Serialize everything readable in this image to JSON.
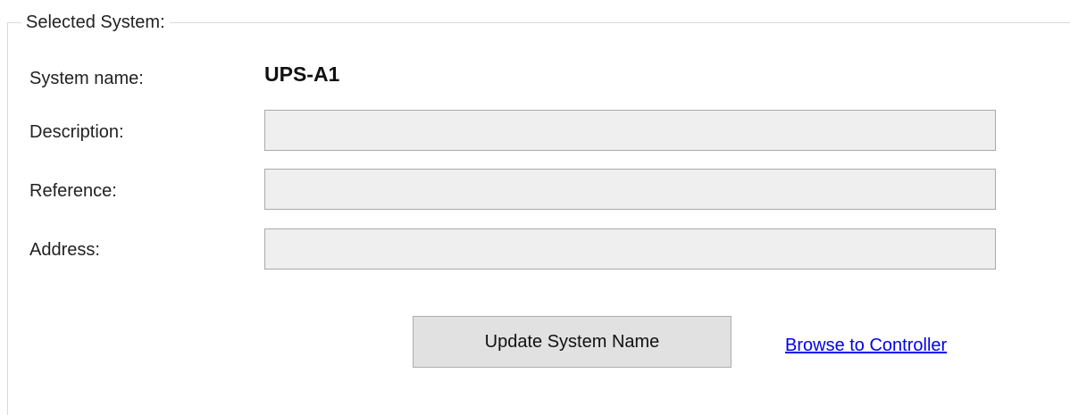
{
  "section": {
    "legend": "Selected System:"
  },
  "system_name": {
    "label": "System name:",
    "value": "UPS-A1"
  },
  "fields": {
    "description": {
      "label": "Description:",
      "value": ""
    },
    "reference": {
      "label": "Reference:",
      "value": ""
    },
    "address": {
      "label": "Address:",
      "value": ""
    }
  },
  "actions": {
    "update_label": "Update System Name",
    "browse_link": "Browse to Controller"
  },
  "colors": {
    "link": "#0000ee",
    "field_background": "#efefef",
    "button_background": "#e1e1e1",
    "border": "#a9a9a9"
  }
}
